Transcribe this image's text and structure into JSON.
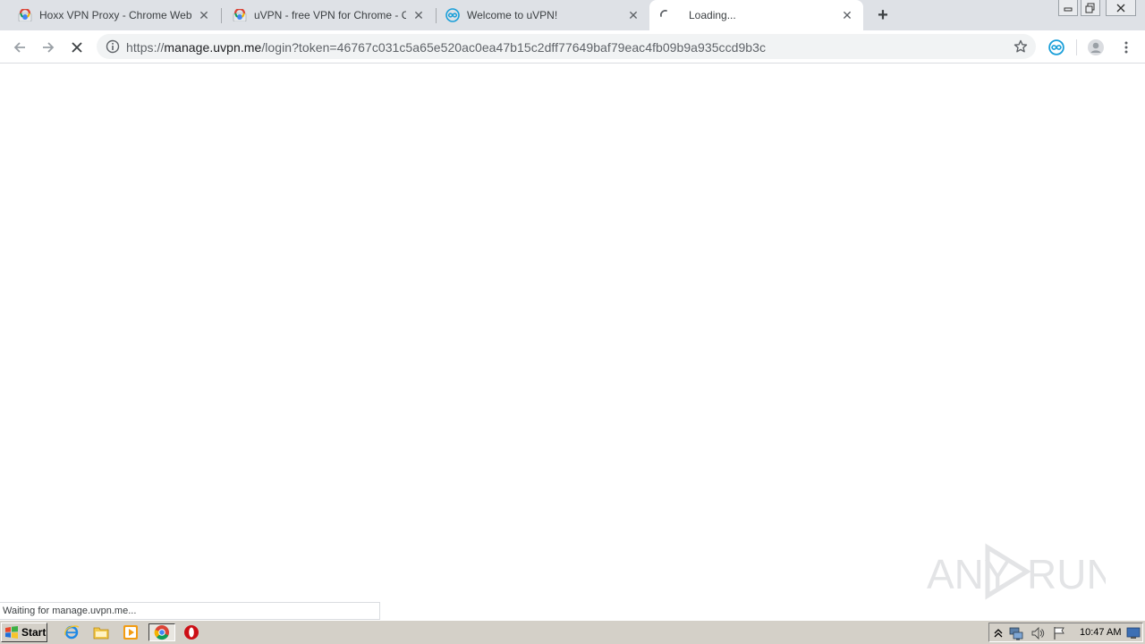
{
  "tabs": [
    {
      "title": "Hoxx VPN Proxy - Chrome Web Store",
      "favicon": "chrome-web-store-icon",
      "active": false
    },
    {
      "title": "uVPN - free VPN for Chrome - Chrome Web Store",
      "favicon": "chrome-web-store-icon",
      "active": false
    },
    {
      "title": "Welcome to uVPN!",
      "favicon": "uvpn-icon",
      "active": false
    },
    {
      "title": "Loading...",
      "favicon": "loading-spinner-icon",
      "active": true
    }
  ],
  "toolbar": {
    "url_scheme": "https://",
    "url_host": "manage.uvpn.me",
    "url_path": "/login?token=46767c031c5a65e520ac0ea47b15c2dff77649baf79eac4fb09b9a935ccd9b3c"
  },
  "status_text": "Waiting for manage.uvpn.me...",
  "watermark_text": "ANY RUN",
  "taskbar": {
    "start_label": "Start",
    "clock": "10:47 AM"
  },
  "colors": {
    "tabstrip": "#dee1e6",
    "accent_uvpn": "#1a9fd9",
    "stop_red": "#cc0000"
  }
}
